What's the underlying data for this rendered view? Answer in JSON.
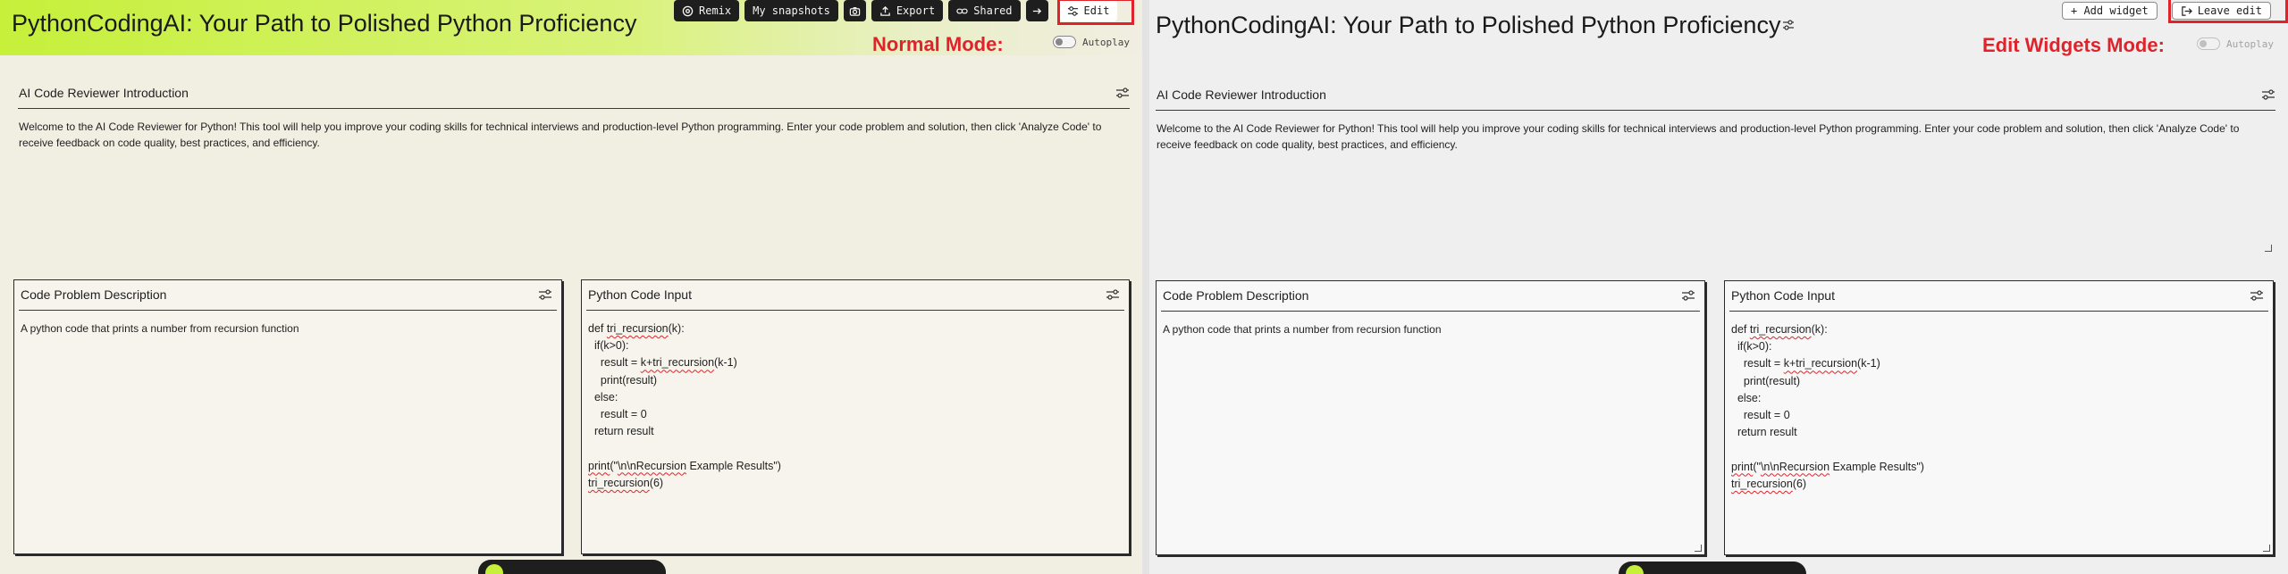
{
  "app": {
    "title": "PythonCodingAI: Your Path to Polished Python Proficiency"
  },
  "toolbar": {
    "remix": "Remix",
    "snapshots": "My snapshots",
    "export": "Export",
    "shared": "Shared",
    "edit": "Edit",
    "add_widget": "+ Add widget",
    "leave_edit": "Leave edit"
  },
  "modes": {
    "normal": "Normal Mode:",
    "edit": "Edit Widgets Mode:"
  },
  "autoplay": {
    "label": "Autoplay",
    "enabled": false
  },
  "widgets": {
    "intro": {
      "title": "AI Code Reviewer Introduction",
      "body": "Welcome to the AI Code Reviewer for Python! This tool will help you improve your coding skills for technical interviews and production-level Python programming. Enter your code problem and solution, then click 'Analyze Code' to receive feedback on code quality, best practices, and efficiency."
    },
    "problem": {
      "title": "Code Problem Description",
      "body": "A python code that prints a number from recursion function"
    },
    "code": {
      "title": "Python Code Input",
      "lines": [
        "def tri_recursion(k):",
        "  if(k>0):",
        "    result = k+tri_recursion(k-1)",
        "    print(result)",
        "  else:",
        "    result = 0",
        "  return result",
        "",
        "print(\"\\n\\nRecursion Example Results\")",
        "tri_recursion(6)"
      ]
    }
  },
  "colors": {
    "accent_lime": "#c6f03a",
    "highlight_red": "#e0232b",
    "toolbar_dark": "#1e1e1e"
  },
  "icons": {
    "remix": "remix-icon",
    "camera": "camera-icon",
    "export": "upload-icon",
    "shared": "link-icon",
    "share_arrow": "arrow-icon",
    "edit": "sliders-icon",
    "leave_edit": "exit-icon",
    "widget_settings": "sliders-icon",
    "title_edit": "sliders-icon"
  }
}
